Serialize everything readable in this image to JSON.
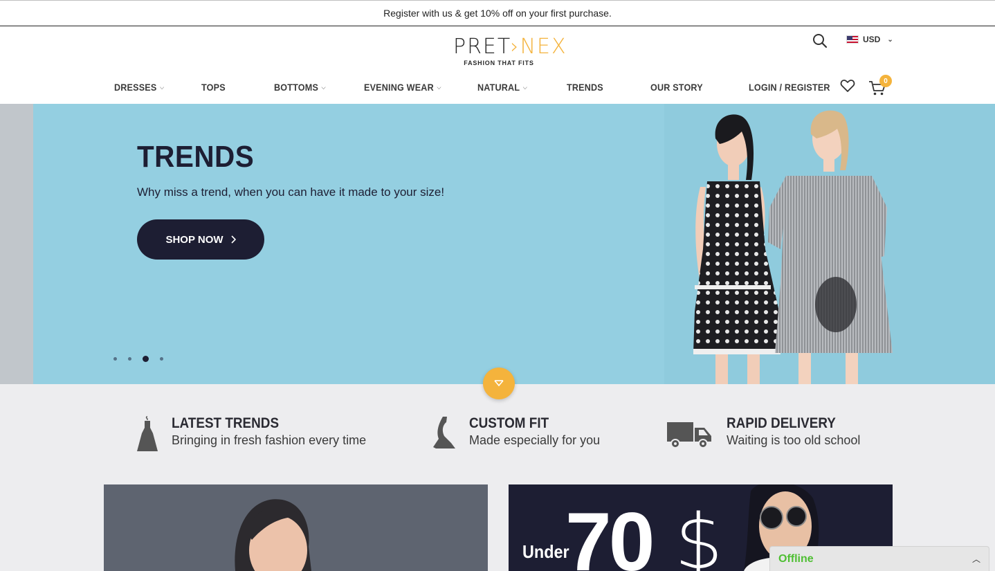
{
  "announcement": {
    "text": "Register with us & get 10% off on your first purchase."
  },
  "logo": {
    "word_left": "PRET",
    "word_sep": "›",
    "word_right": "NEX",
    "tagline": "FASHION THAT FITS"
  },
  "header": {
    "currency": "USD",
    "cart_count": "0",
    "icons": [
      "search-icon",
      "us-flag-icon",
      "heart-icon",
      "cart-icon"
    ]
  },
  "nav": {
    "items": [
      {
        "label": "DRESSES",
        "dropdown": true
      },
      {
        "label": "TOPS",
        "dropdown": false
      },
      {
        "label": "BOTTOMS",
        "dropdown": true
      },
      {
        "label": "EVENING WEAR",
        "dropdown": true
      },
      {
        "label": "NATURAL",
        "dropdown": true
      },
      {
        "label": "TRENDS",
        "dropdown": false
      },
      {
        "label": "OUR STORY",
        "dropdown": false
      },
      {
        "label": "LOGIN / REGISTER",
        "dropdown": false
      }
    ]
  },
  "hero": {
    "title": "TRENDS",
    "subtitle": "Why miss a trend, when you can have it made to your size!",
    "cta": "SHOP NOW",
    "slides_total": 4,
    "active_slide": 3
  },
  "features": [
    {
      "title": "LATEST TRENDS",
      "desc": "Bringing in fresh fashion every time",
      "icon": "dress-icon"
    },
    {
      "title": "CUSTOM FIT",
      "desc": "Made especially for you",
      "icon": "mannequin-icon"
    },
    {
      "title": "RAPID DELIVERY",
      "desc": "Waiting is too old school",
      "icon": "truck-icon"
    }
  ],
  "promo": {
    "under": "Under",
    "amount": "70",
    "currency_symbol": "$"
  },
  "chat": {
    "status": "Offline"
  },
  "colors": {
    "accent": "#f4b33c",
    "dark": "#1d1e33",
    "hero_bg": "#94cfe1",
    "features_bg": "#ededef",
    "chat_online": "#4fbf33"
  }
}
